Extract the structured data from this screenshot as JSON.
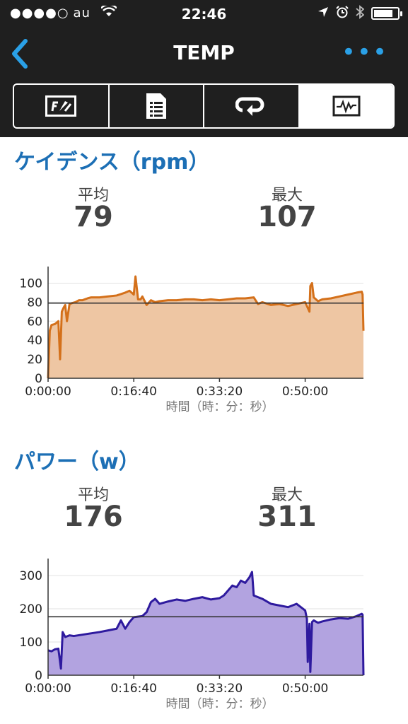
{
  "status_bar": {
    "signal": "●●●●○",
    "carrier": "au",
    "time": "22:46"
  },
  "nav": {
    "title": "TEMP",
    "more": "•••"
  },
  "tabs": [
    {
      "icon": "speedometer-icon",
      "active": false
    },
    {
      "icon": "document-list-icon",
      "active": false
    },
    {
      "icon": "loop-icon",
      "active": false
    },
    {
      "icon": "chart-icon",
      "active": true
    }
  ],
  "cadence": {
    "title": "ケイデンス（rpm）",
    "avg_label": "平均",
    "avg_value": "79",
    "max_label": "最大",
    "max_value": "107"
  },
  "power": {
    "title": "パワー（w）",
    "avg_label": "平均",
    "avg_value": "176",
    "max_label": "最大",
    "max_value": "311"
  },
  "colors": {
    "accent": "#1c6fb5",
    "cadence_line": "#d4701a",
    "cadence_fill": "#eec6a3",
    "power_line": "#2e1a9e",
    "power_fill": "#b2a3e0"
  },
  "chart_data": [
    {
      "type": "area",
      "xlabel": "時間（時：分：秒）",
      "ylabel": "",
      "x_ticks": [
        "0:00:00",
        "0:16:40",
        "0:33:20",
        "0:50:00"
      ],
      "x_tick_seconds": [
        0,
        1000,
        2000,
        3000
      ],
      "xlim": [
        0,
        3680
      ],
      "ylim": [
        0,
        110
      ],
      "y_ticks": [
        0,
        20,
        40,
        60,
        80,
        100
      ],
      "average_line": 79,
      "series": [
        {
          "x": [
            0,
            20,
            40,
            80,
            120,
            140,
            160,
            180,
            200,
            220,
            250,
            280,
            320,
            360,
            400,
            430,
            460,
            500,
            600,
            700,
            800,
            900,
            950,
            1000,
            1020,
            1050,
            1080,
            1100,
            1150,
            1200,
            1250,
            1300,
            1400,
            1500,
            1600,
            1700,
            1800,
            1900,
            2000,
            2100,
            2200,
            2300,
            2400,
            2450,
            2500,
            2600,
            2700,
            2800,
            2900,
            3000,
            3050,
            3060,
            3080,
            3100,
            3150,
            3200,
            3300,
            3400,
            3500,
            3600,
            3660,
            3670,
            3680
          ],
          "values": [
            0,
            50,
            56,
            57,
            60,
            20,
            70,
            74,
            77,
            60,
            78,
            79,
            80,
            82,
            82,
            83,
            84,
            85,
            85,
            86,
            87,
            90,
            92,
            88,
            107,
            83,
            83,
            86,
            77,
            82,
            80,
            81,
            82,
            82,
            83,
            83,
            82,
            83,
            82,
            83,
            84,
            84,
            85,
            78,
            80,
            77,
            78,
            76,
            78,
            80,
            70,
            97,
            100,
            85,
            81,
            83,
            84,
            86,
            88,
            90,
            91,
            88,
            50
          ]
        }
      ]
    },
    {
      "type": "area",
      "xlabel": "時間（時：分：秒）",
      "ylabel": "",
      "x_ticks": [
        "0:00:00",
        "0:16:40",
        "0:33:20",
        "0:50:00"
      ],
      "x_tick_seconds": [
        0,
        1000,
        2000,
        3000
      ],
      "xlim": [
        0,
        3680
      ],
      "ylim": [
        0,
        330
      ],
      "y_ticks": [
        0,
        100,
        200,
        300
      ],
      "average_line": 176,
      "series": [
        {
          "x": [
            0,
            40,
            80,
            120,
            150,
            170,
            200,
            250,
            300,
            400,
            500,
            600,
            700,
            800,
            850,
            900,
            950,
            1000,
            1100,
            1150,
            1200,
            1250,
            1300,
            1400,
            1500,
            1600,
            1700,
            1800,
            1900,
            2000,
            2050,
            2100,
            2150,
            2200,
            2250,
            2300,
            2350,
            2380,
            2400,
            2450,
            2500,
            2600,
            2700,
            2800,
            2900,
            3000,
            3020,
            3030,
            3050,
            3060,
            3080,
            3100,
            3150,
            3200,
            3300,
            3400,
            3500,
            3600,
            3660,
            3670,
            3680
          ],
          "values": [
            75,
            72,
            78,
            80,
            20,
            130,
            115,
            120,
            118,
            122,
            126,
            130,
            135,
            140,
            165,
            140,
            160,
            175,
            178,
            190,
            220,
            230,
            215,
            222,
            228,
            224,
            230,
            235,
            228,
            232,
            240,
            255,
            270,
            265,
            285,
            278,
            295,
            311,
            240,
            235,
            230,
            215,
            210,
            205,
            215,
            195,
            170,
            40,
            155,
            10,
            160,
            165,
            158,
            162,
            168,
            172,
            170,
            178,
            185,
            182,
            0
          ]
        }
      ]
    }
  ]
}
